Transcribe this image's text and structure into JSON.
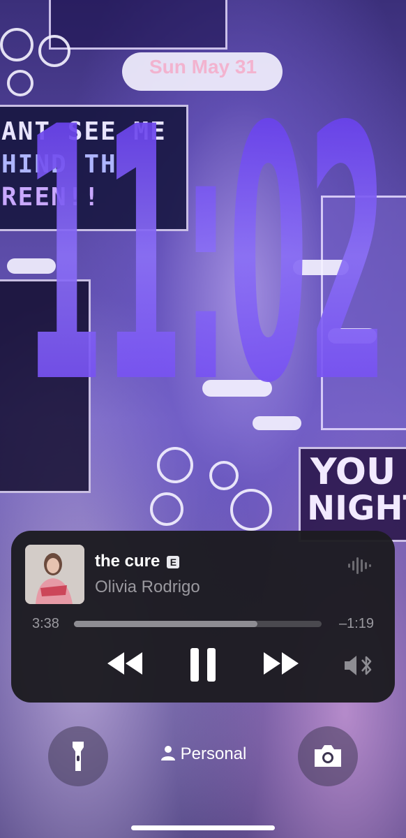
{
  "lockscreen": {
    "date": "Sun May 31",
    "time": "11:02"
  },
  "wallpaper": {
    "banner_lines": [
      "ANT SEE ME",
      "HIND TH",
      "REEN!!"
    ],
    "you_text": [
      "YOU",
      "NIGHT"
    ]
  },
  "now_playing": {
    "title": "the cure",
    "explicit_badge": "E",
    "artist": "Olivia Rodrigo",
    "elapsed": "3:38",
    "remaining": "–1:19",
    "progress": 0.74,
    "icons": {
      "waveform": "audio-waveform-icon",
      "rewind": "rewind-icon",
      "pause": "pause-icon",
      "forward": "fast-forward-icon",
      "output": "speaker-bluetooth-icon"
    }
  },
  "bottom": {
    "focus_label": "Personal",
    "icons": {
      "left": "flashlight-icon",
      "right": "camera-icon",
      "focus": "person-icon"
    }
  },
  "colors": {
    "clock": "#6a3df0",
    "date": "#f5aac8",
    "player_bg": "#1c1b20"
  }
}
